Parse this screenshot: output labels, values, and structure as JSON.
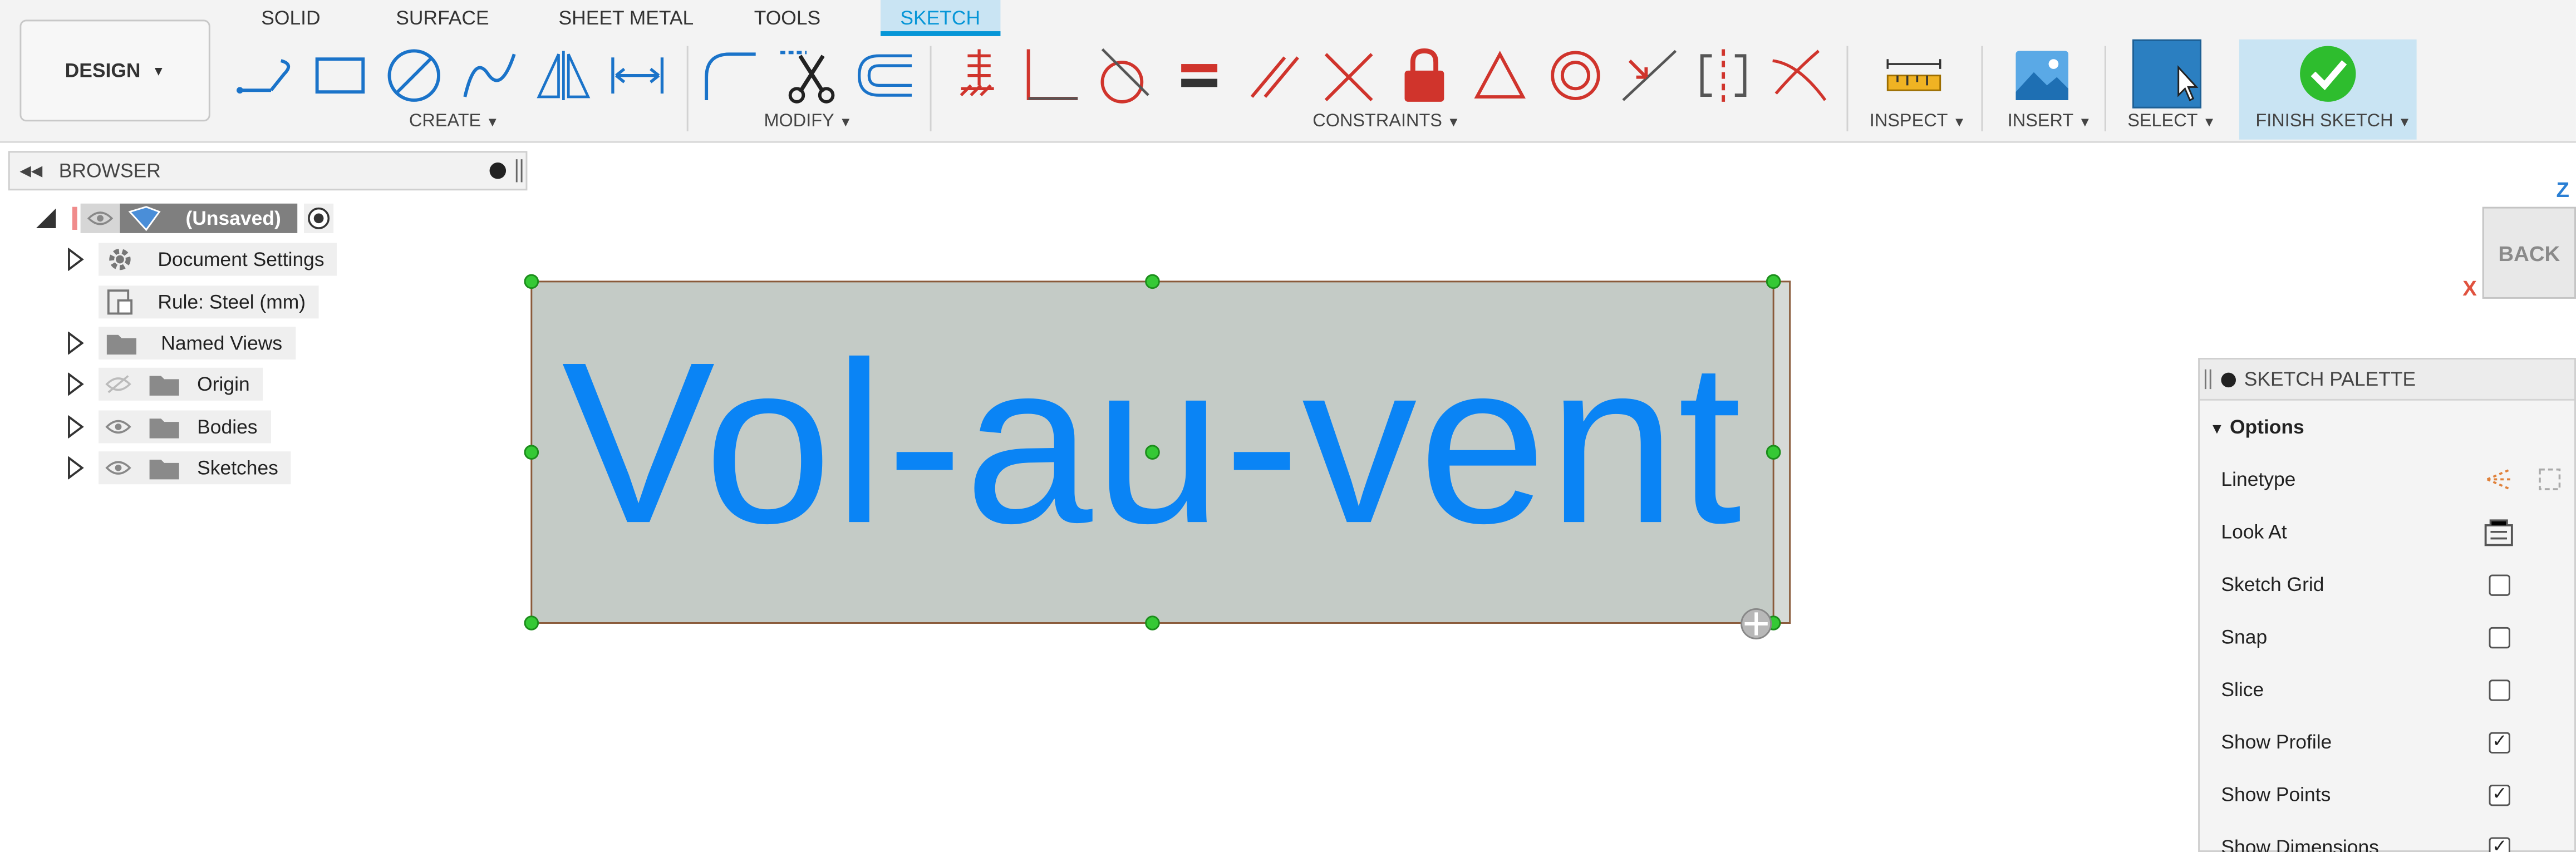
{
  "toolbar": {
    "workspace_button": "DESIGN",
    "tabs": [
      "SOLID",
      "SURFACE",
      "SHEET METAL",
      "TOOLS",
      "SKETCH"
    ],
    "active_tab": "SKETCH",
    "groups": {
      "create": "CREATE",
      "modify": "MODIFY",
      "constraints": "CONSTRAINTS",
      "inspect": "INSPECT",
      "insert": "INSERT",
      "select": "SELECT",
      "finish": "FINISH SKETCH"
    },
    "icons": {
      "create": [
        "line-icon",
        "rectangle-icon",
        "circle-icon",
        "spline-icon",
        "mirror-icon",
        "dimension-icon"
      ],
      "modify": [
        "fillet-icon",
        "trim-icon",
        "offset-icon"
      ],
      "constraints": [
        "fix-icon",
        "coincident-icon",
        "tangent-icon",
        "equal-icon",
        "parallel-icon",
        "perpendicular-icon",
        "lock-icon",
        "triangle-icon",
        "concentric-icon",
        "midpoint-icon",
        "symmetry-icon",
        "curvature-icon"
      ],
      "inspect": "measure-icon",
      "insert": "insert-image-icon",
      "select": "select-cursor-icon",
      "finish": "checkmark-icon"
    }
  },
  "browser": {
    "title": "BROWSER",
    "root_label": "(Unsaved)",
    "items": [
      {
        "label": "Document Settings",
        "icon": "gear-icon",
        "expandable": true
      },
      {
        "label": "Rule: Steel (mm)",
        "icon": "rule-icon",
        "expandable": false
      },
      {
        "label": "Named Views",
        "icon": "folder-icon",
        "expandable": true
      },
      {
        "label": "Origin",
        "icon": "folder-icon",
        "expandable": true,
        "visibility": "hidden"
      },
      {
        "label": "Bodies",
        "icon": "folder-icon",
        "expandable": true,
        "visibility": "visible"
      },
      {
        "label": "Sketches",
        "icon": "folder-icon",
        "expandable": true,
        "visibility": "visible"
      }
    ]
  },
  "canvas": {
    "sketch_text": "Vol-au-vent",
    "text_color": "#0a84f5",
    "fill_color": "#c4cbc6"
  },
  "viewcube": {
    "face_label": "BACK",
    "axis_z": "Z",
    "axis_x": "X"
  },
  "palette": {
    "title": "SKETCH PALETTE",
    "section": "Options",
    "options": [
      {
        "label": "Linetype",
        "type": "icons"
      },
      {
        "label": "Look At",
        "type": "button"
      },
      {
        "label": "Sketch Grid",
        "type": "checkbox",
        "checked": false
      },
      {
        "label": "Snap",
        "type": "checkbox",
        "checked": false
      },
      {
        "label": "Slice",
        "type": "checkbox",
        "checked": false
      },
      {
        "label": "Show Profile",
        "type": "checkbox",
        "checked": true
      },
      {
        "label": "Show Points",
        "type": "checkbox",
        "checked": true
      },
      {
        "label": "Show Dimensions",
        "type": "checkbox",
        "checked": true
      }
    ]
  },
  "colors": {
    "accent": "#0696d7",
    "point_green": "#35c935",
    "finish_green": "#2ebd2e"
  }
}
